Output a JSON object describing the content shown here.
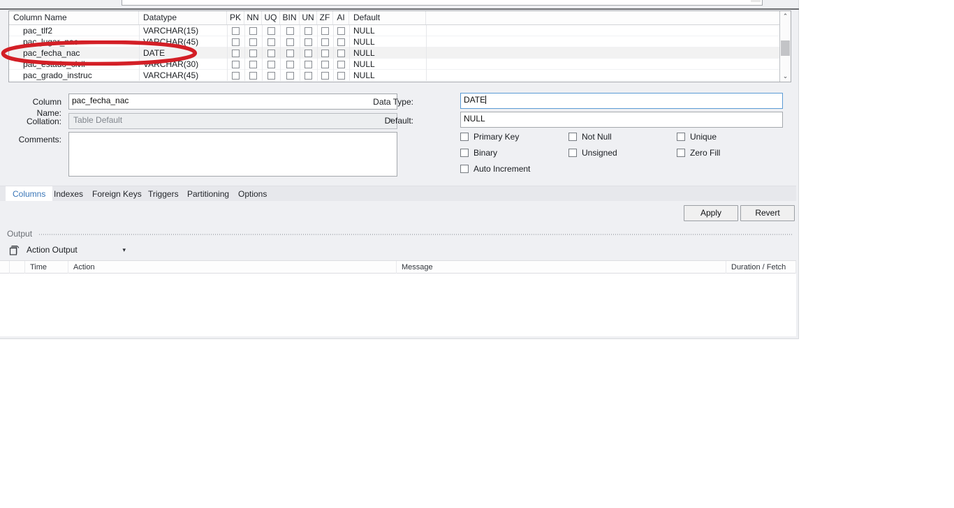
{
  "app": {
    "name": "mysql-workbench-table-editor"
  },
  "columns_grid": {
    "headers": [
      "Column Name",
      "Datatype",
      "PK",
      "NN",
      "UQ",
      "BIN",
      "UN",
      "ZF",
      "AI",
      "Default"
    ],
    "rows": [
      {
        "name": "pac_tlf2",
        "datatype": "VARCHAR(15)",
        "pk": false,
        "nn": false,
        "uq": false,
        "bin": false,
        "un": false,
        "zf": false,
        "ai": false,
        "default": "NULL",
        "selected": false
      },
      {
        "name": "pac_lugar_nac",
        "datatype": "VARCHAR(45)",
        "pk": false,
        "nn": false,
        "uq": false,
        "bin": false,
        "un": false,
        "zf": false,
        "ai": false,
        "default": "NULL",
        "selected": false
      },
      {
        "name": "pac_fecha_nac",
        "datatype": "DATE",
        "pk": false,
        "nn": false,
        "uq": false,
        "bin": false,
        "un": false,
        "zf": false,
        "ai": false,
        "default": "NULL",
        "selected": true
      },
      {
        "name": "pac_estado_civil",
        "datatype": "VARCHAR(30)",
        "pk": false,
        "nn": false,
        "uq": false,
        "bin": false,
        "un": false,
        "zf": false,
        "ai": false,
        "default": "NULL",
        "selected": false
      },
      {
        "name": "pac_grado_instruc",
        "datatype": "VARCHAR(45)",
        "pk": false,
        "nn": false,
        "uq": false,
        "bin": false,
        "un": false,
        "zf": false,
        "ai": false,
        "default": "NULL",
        "selected": false
      }
    ],
    "scrollbar": {
      "up_glyph": "⌃",
      "down_glyph": "⌄"
    }
  },
  "annotation": {
    "shape": "ellipse",
    "color": "#D31F26",
    "target_row": "pac_fecha_nac"
  },
  "detail": {
    "column_name_label": "Column Name:",
    "column_name_value": "pac_fecha_nac",
    "collation_label": "Collation:",
    "collation_value": "Table Default",
    "comments_label": "Comments:",
    "comments_value": "",
    "data_type_label": "Data Type:",
    "data_type_value": "DATE",
    "default_label": "Default:",
    "default_value": "NULL",
    "flags": [
      {
        "label": "Primary Key",
        "checked": false
      },
      {
        "label": "Not Null",
        "checked": false
      },
      {
        "label": "Unique",
        "checked": false
      },
      {
        "label": "Binary",
        "checked": false
      },
      {
        "label": "Unsigned",
        "checked": false
      },
      {
        "label": "Zero Fill",
        "checked": false
      },
      {
        "label": "Auto Increment",
        "checked": false
      }
    ]
  },
  "tabs": {
    "items": [
      {
        "label": "Columns",
        "active": true
      },
      {
        "label": "Indexes",
        "active": false
      },
      {
        "label": "Foreign Keys",
        "active": false
      },
      {
        "label": "Triggers",
        "active": false
      },
      {
        "label": "Partitioning",
        "active": false
      },
      {
        "label": "Options",
        "active": false
      }
    ]
  },
  "actions": {
    "apply_label": "Apply",
    "revert_label": "Revert"
  },
  "output": {
    "title": "Output",
    "type_selected": "Action Output",
    "chevron": "▾",
    "headers": [
      "Time",
      "Action",
      "Message",
      "Duration / Fetch"
    ],
    "rows": []
  },
  "colors": {
    "accent": "#3A76B8",
    "annotation_red": "#D31F26",
    "panel_bg": "#EFF0F3",
    "focus_border": "#5B9BD5"
  }
}
